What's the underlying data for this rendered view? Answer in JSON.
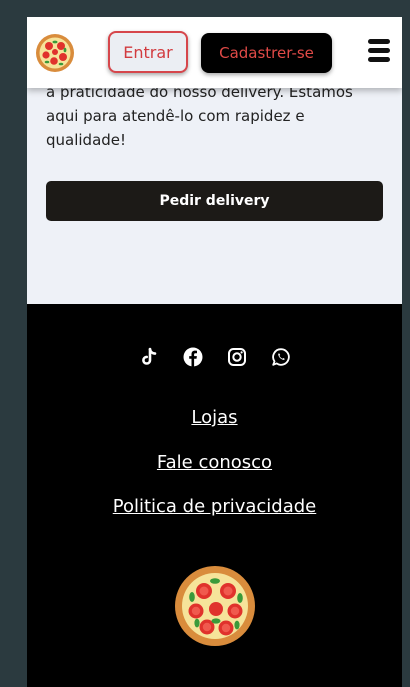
{
  "header": {
    "entrar_label": "Entrar",
    "cadastrar_label": "Cadastrer-se",
    "logo_icon": "pizza-icon",
    "menu_icon": "hamburger-menu-icon"
  },
  "hero": {
    "text": "a praticidade do nosso delivery. Estamos aqui para atendê-lo com rapidez e qualidade!",
    "button_label": "Pedir delivery"
  },
  "footer": {
    "socials": [
      "tiktok-icon",
      "facebook-icon",
      "instagram-icon",
      "whatsapp-icon"
    ],
    "links": [
      "Lojas",
      "Fale conosco",
      "Politica de privacidade"
    ],
    "logo_icon": "pizza-icon"
  },
  "colors": {
    "accent": "#d6464b",
    "page_bg": "#eef1f7",
    "footer_bg": "#000000",
    "outer_bg": "#2b3a3f"
  }
}
